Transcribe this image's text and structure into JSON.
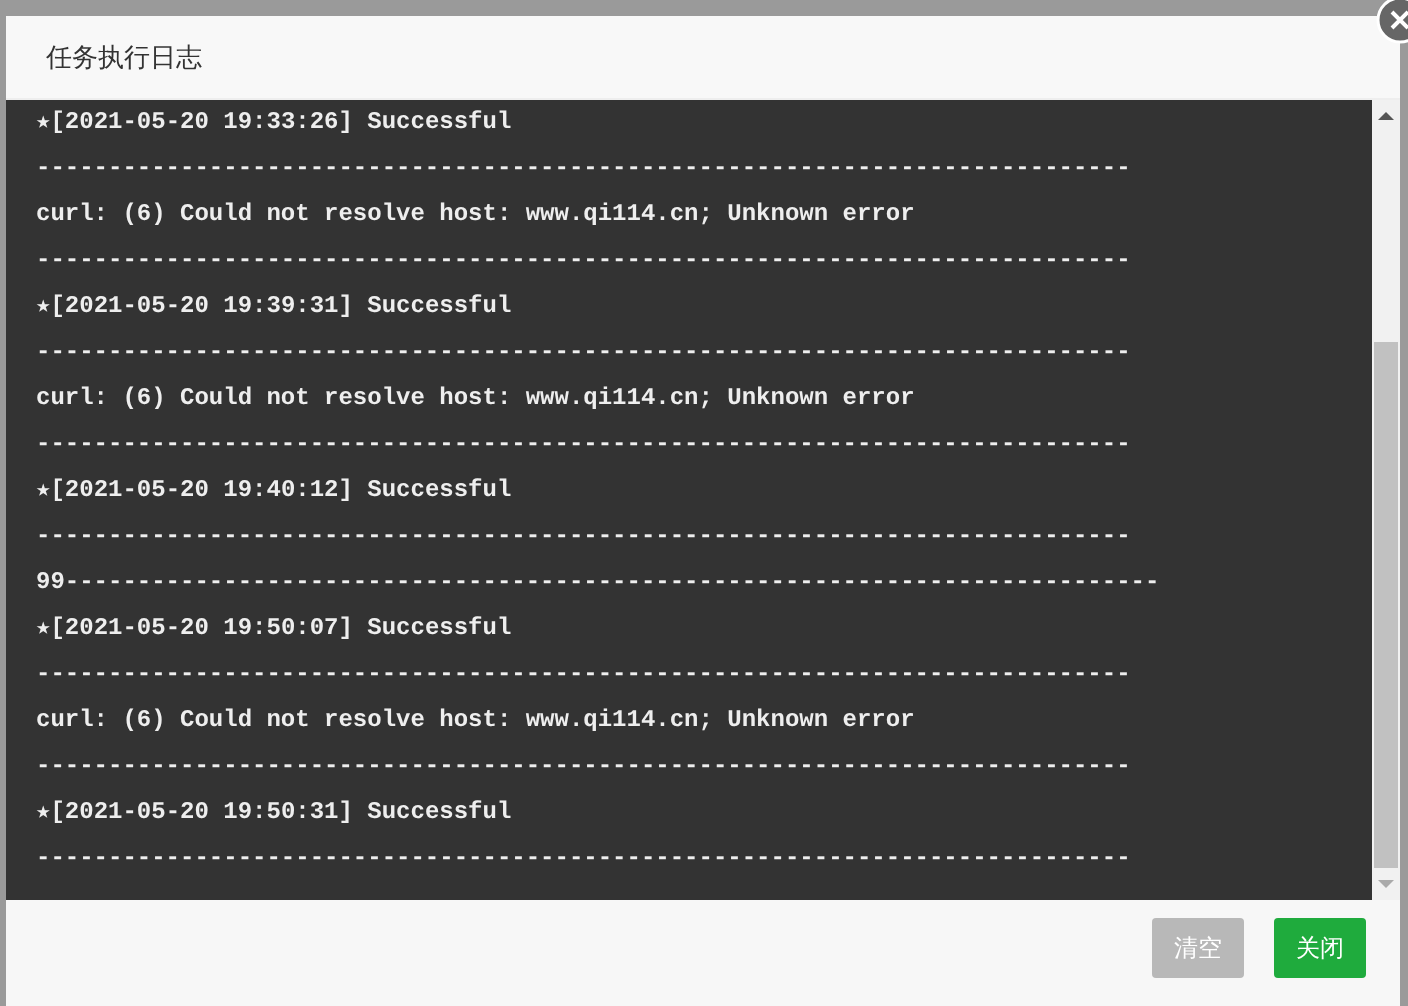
{
  "dialog": {
    "title": "任务执行日志"
  },
  "log_lines": [
    "★[2021-05-20 19:33:26] Successful",
    "----------------------------------------------------------------------------",
    "curl: (6) Could not resolve host: www.qi114.cn; Unknown error",
    "----------------------------------------------------------------------------",
    "★[2021-05-20 19:39:31] Successful",
    "----------------------------------------------------------------------------",
    "curl: (6) Could not resolve host: www.qi114.cn; Unknown error",
    "----------------------------------------------------------------------------",
    "★[2021-05-20 19:40:12] Successful",
    "----------------------------------------------------------------------------",
    "99----------------------------------------------------------------------------",
    "★[2021-05-20 19:50:07] Successful",
    "----------------------------------------------------------------------------",
    "curl: (6) Could not resolve host: www.qi114.cn; Unknown error",
    "----------------------------------------------------------------------------",
    "★[2021-05-20 19:50:31] Successful",
    "----------------------------------------------------------------------------"
  ],
  "buttons": [
    {
      "label": "清空",
      "disabled": true
    },
    {
      "label": "关闭",
      "disabled": false
    }
  ]
}
